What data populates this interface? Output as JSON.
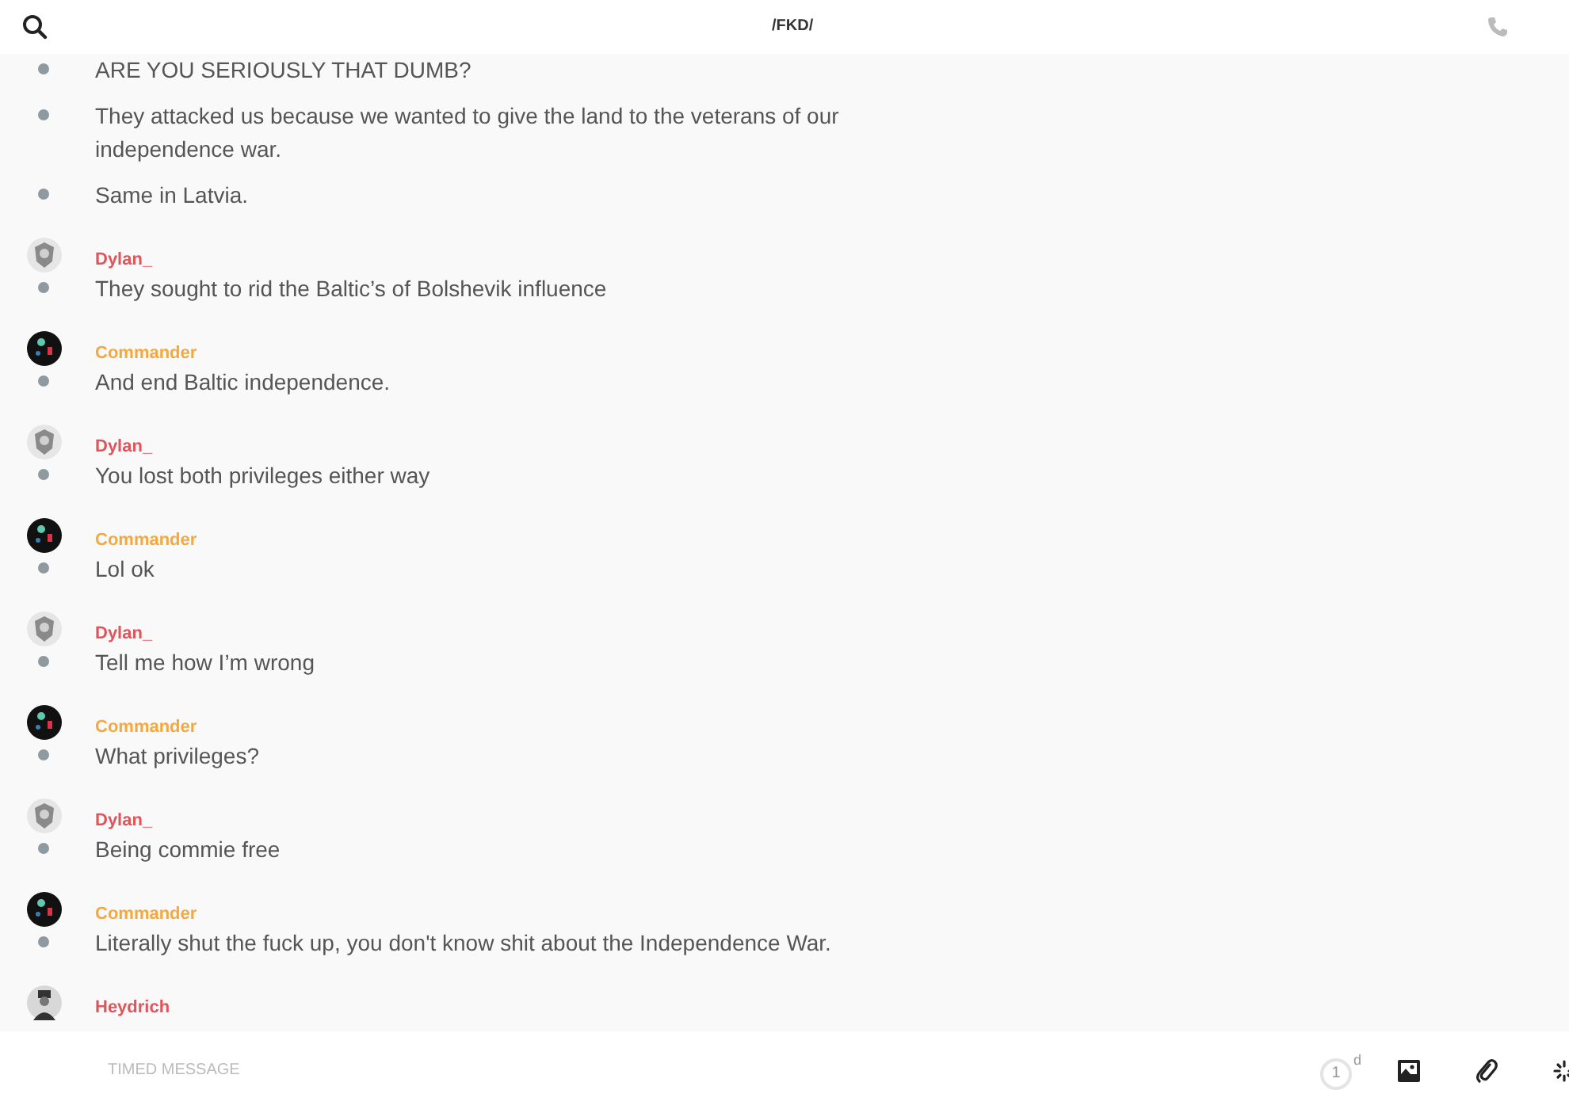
{
  "header": {
    "title": "/FKD/"
  },
  "messages": [
    {
      "text": "ARE YOU SERIOUSLY THAT DUMB?"
    },
    {
      "text": "They attacked us because we wanted to give the land to the veterans of our independence war."
    },
    {
      "text": "Same in Latvia."
    },
    {
      "author": "Dylan_",
      "color": "#e0555a",
      "avatar": {
        "kind": "emblem"
      },
      "text": "They sought to rid the Baltic’s of Bolshevik influence"
    },
    {
      "author": "Commander",
      "color": "#f5a83c",
      "avatar": {
        "kind": "dark"
      },
      "text": "And end Baltic independence."
    },
    {
      "author": "Dylan_",
      "color": "#e0555a",
      "avatar": {
        "kind": "emblem"
      },
      "text": "You lost both privileges either way"
    },
    {
      "author": "Commander",
      "color": "#f5a83c",
      "avatar": {
        "kind": "dark"
      },
      "text": "Lol ok"
    },
    {
      "author": "Dylan_",
      "color": "#e0555a",
      "avatar": {
        "kind": "emblem"
      },
      "text": "Tell me how I’m wrong"
    },
    {
      "author": "Commander",
      "color": "#f5a83c",
      "avatar": {
        "kind": "dark"
      },
      "text": "What privileges?"
    },
    {
      "author": "Dylan_",
      "color": "#e0555a",
      "avatar": {
        "kind": "emblem"
      },
      "text": "Being commie  free"
    },
    {
      "author": "Commander",
      "color": "#f5a83c",
      "avatar": {
        "kind": "dark"
      },
      "text": "Literally shut the fuck up, you don't know shit about the Independence War."
    },
    {
      "author": "Heydrich",
      "color": "#e0555a",
      "avatar": {
        "kind": "portrait"
      }
    }
  ],
  "composer": {
    "placeholder": "TIMED MESSAGE",
    "timer_value": "1",
    "timer_unit": "d"
  }
}
